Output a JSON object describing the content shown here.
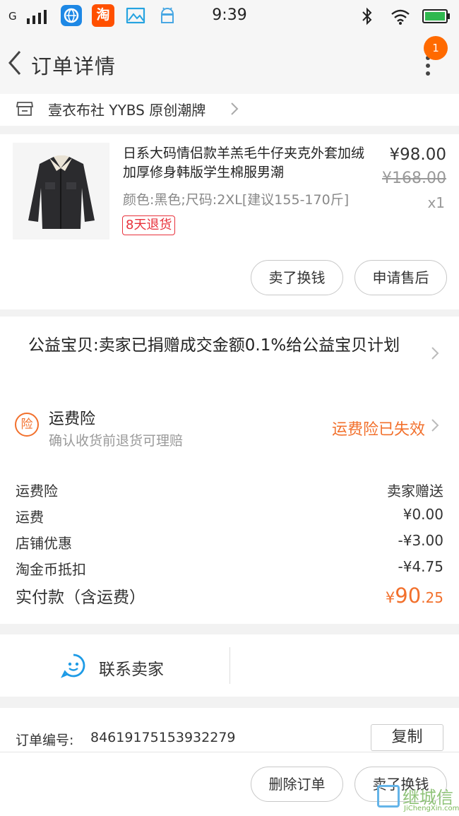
{
  "status_bar": {
    "signal": "G",
    "time": "9:39",
    "taobao_icon_text": "淘",
    "colors": {
      "taobao": "#ff5000",
      "browser": "#1e88e5",
      "gallery": "#26a3e0",
      "android": "#48a7e3"
    }
  },
  "header": {
    "title": "订单详情",
    "notification_count": "1"
  },
  "shop": {
    "name": "壹衣布社 YYBS 原创潮牌"
  },
  "product": {
    "name": "日系大码情侣款羊羔毛牛仔夹克外套加绒加厚修身韩版学生棉服男潮",
    "spec": "颜色:黑色;尺码:2XL[建议155-170斤]",
    "price": "¥98.00",
    "original_price": "¥168.00",
    "quantity": "x1",
    "return_tag": "8天退货",
    "buttons": {
      "sell": "卖了换钱",
      "after_sale": "申请售后"
    }
  },
  "charity": {
    "text": "公益宝贝:卖家已捐赠成交金额0.1%给公益宝贝计划"
  },
  "insurance": {
    "icon_text": "险",
    "title": "运费险",
    "subtitle": "确认收货前退货可理赔",
    "status": "运费险已失效"
  },
  "fees": [
    {
      "label": "运费险",
      "value": "卖家赠送"
    },
    {
      "label": "运费",
      "value": "¥0.00"
    },
    {
      "label": "店铺优惠",
      "value": "-¥3.00"
    },
    {
      "label": "淘金币抵扣",
      "value": "-¥4.75"
    }
  ],
  "total": {
    "label": "实付款（含运费）",
    "currency": "¥",
    "integer": "90",
    "decimal": ".25"
  },
  "contact": {
    "label": "联系卖家"
  },
  "order": {
    "label": "订单编号:",
    "number": "84619175153932279",
    "copy": "复制"
  },
  "bottom": {
    "delete": "删除订单",
    "sell": "卖了换钱"
  },
  "watermark": {
    "text": "继城信",
    "sub": "JiChengXin.com"
  },
  "accent_color": "#f2702c"
}
